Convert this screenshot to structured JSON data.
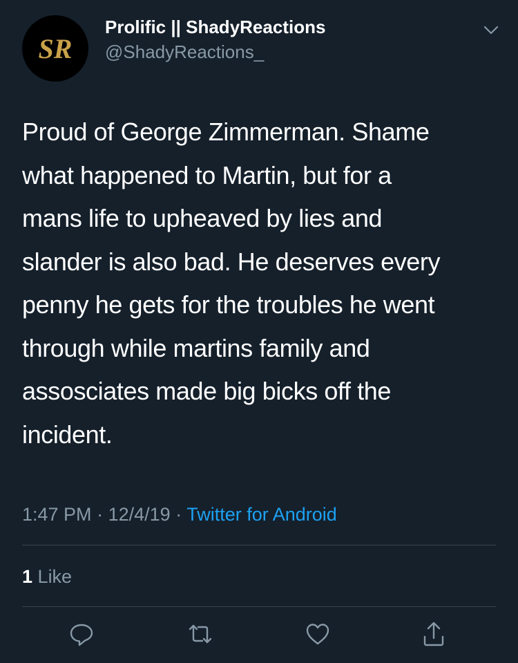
{
  "tweet": {
    "display_name": "Prolific || ShadyReactions",
    "handle": "@ShadyReactions_",
    "avatar_initials": "SR",
    "text_lines": [
      "Proud of George Zimmerman. Shame",
      "what happened to Martin, but for a",
      "mans life to upheaved by lies and",
      "slander is also bad. He deserves every",
      "penny he gets for the troubles he went",
      "through while martins family and",
      "assosciates made big bicks off the",
      "incident."
    ],
    "time": "1:47 PM",
    "separator": "·",
    "date": "12/4/19",
    "source": "Twitter for Android",
    "like_count": "1",
    "like_label": "Like"
  },
  "icons": {
    "menu": "chevron-down-icon",
    "reply": "reply-icon",
    "retweet": "retweet-icon",
    "like": "heart-icon",
    "share": "share-icon"
  },
  "colors": {
    "background": "#15202b",
    "text": "#ffffff",
    "secondary": "#8899a6",
    "link": "#1da1f2",
    "divider": "#38444d",
    "avatar_gold": "#c9a24a"
  }
}
